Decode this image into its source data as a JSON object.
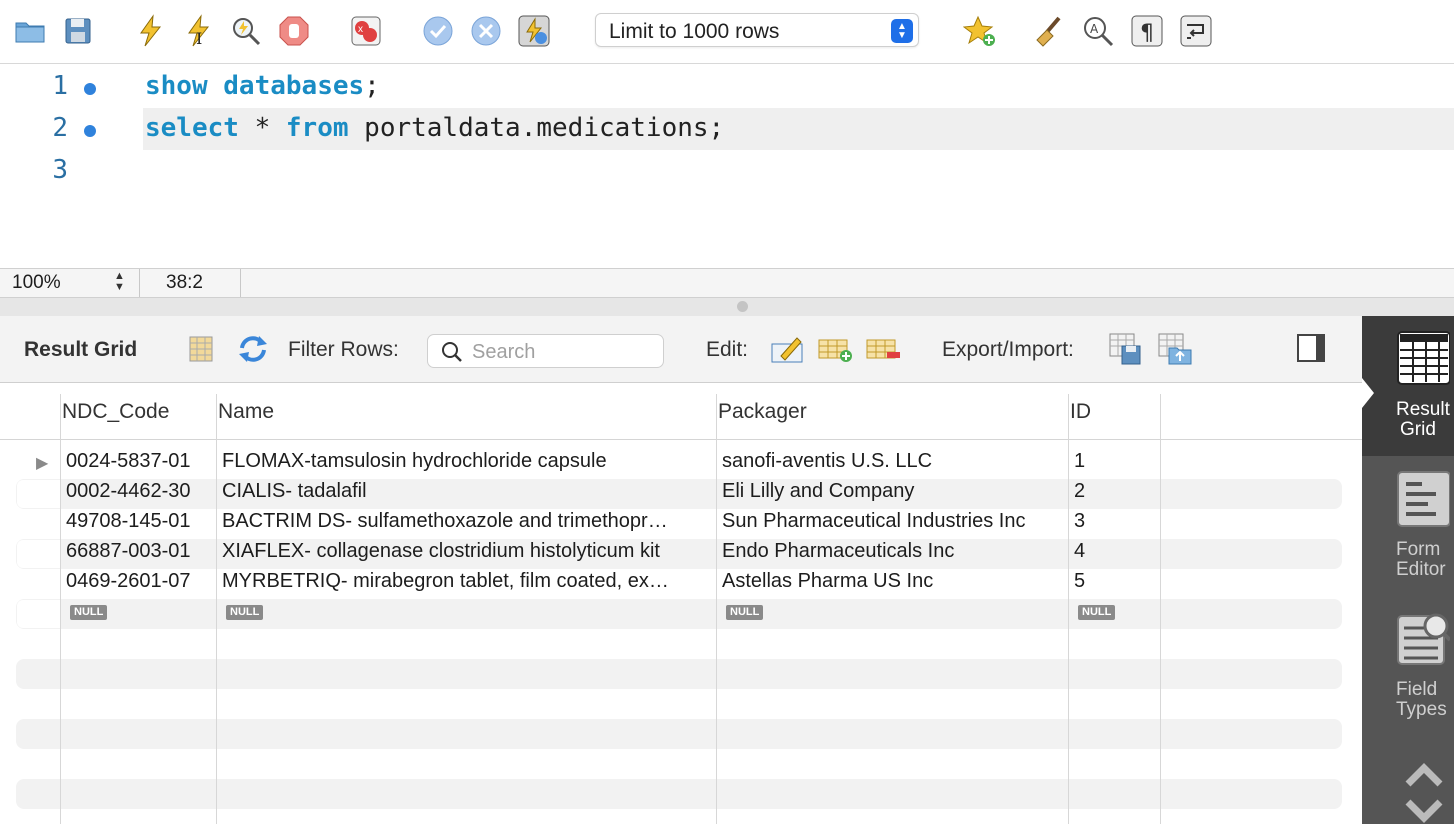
{
  "toolbar": {
    "limit_select": "Limit to 1000 rows",
    "icons": [
      "open-file-icon",
      "save-icon",
      "execute-icon",
      "execute-current-icon",
      "explain-icon",
      "stop-icon",
      "toggle-error-icon",
      "commit-icon",
      "rollback-icon",
      "autocommit-icon",
      "bookmark-icon",
      "beautify-icon",
      "find-icon",
      "invisible-chars-icon",
      "wrap-lines-icon"
    ]
  },
  "editor": {
    "lines": [
      {
        "num": "1",
        "kw1": "show",
        "kw2": "databases",
        "rest": ";"
      },
      {
        "num": "2",
        "kw1": "select",
        "op": " * ",
        "kw2": "from",
        "rest": " portaldata.medications;"
      },
      {
        "num": "3"
      }
    ]
  },
  "status": {
    "zoom": "100%",
    "cursor": "38:2"
  },
  "results": {
    "title": "Result Grid",
    "filter_label": "Filter Rows:",
    "search_placeholder": "Search",
    "edit_label": "Edit:",
    "export_label": "Export/Import:",
    "columns": [
      "NDC_Code",
      "Name",
      "Packager",
      "ID"
    ],
    "rows": [
      {
        "ndc": "0024-5837-01",
        "name": "FLOMAX-tamsulosin hydrochloride capsule",
        "packager": "sanofi-aventis U.S. LLC",
        "id": "1"
      },
      {
        "ndc": "0002-4462-30",
        "name": "CIALIS- tadalafil",
        "packager": "Eli Lilly and Company",
        "id": "2"
      },
      {
        "ndc": "49708-145-01",
        "name": "BACTRIM DS- sulfamethoxazole and trimethopr…",
        "packager": "Sun Pharmaceutical Industries Inc",
        "id": "3"
      },
      {
        "ndc": "66887-003-01",
        "name": "XIAFLEX- collagenase clostridium histolyticum kit",
        "packager": "Endo Pharmaceuticals Inc",
        "id": "4"
      },
      {
        "ndc": "0469-2601-07",
        "name": "MYRBETRIQ- mirabegron tablet, film coated, ex…",
        "packager": "Astellas Pharma US Inc",
        "id": "5"
      }
    ],
    "null_label": "NULL"
  },
  "side_panel": {
    "items": [
      {
        "label_line1": "Result",
        "label_line2": "Grid"
      },
      {
        "label_line1": "Form",
        "label_line2": "Editor"
      },
      {
        "label_line1": "Field",
        "label_line2": "Types"
      }
    ]
  },
  "colors": {
    "keyword": "#1a8cc4",
    "line_number": "#2a6fa3",
    "breakpoint_dot": "#2f82dc",
    "side_panel": "#555555",
    "select_accent": "#1f6fe8"
  }
}
